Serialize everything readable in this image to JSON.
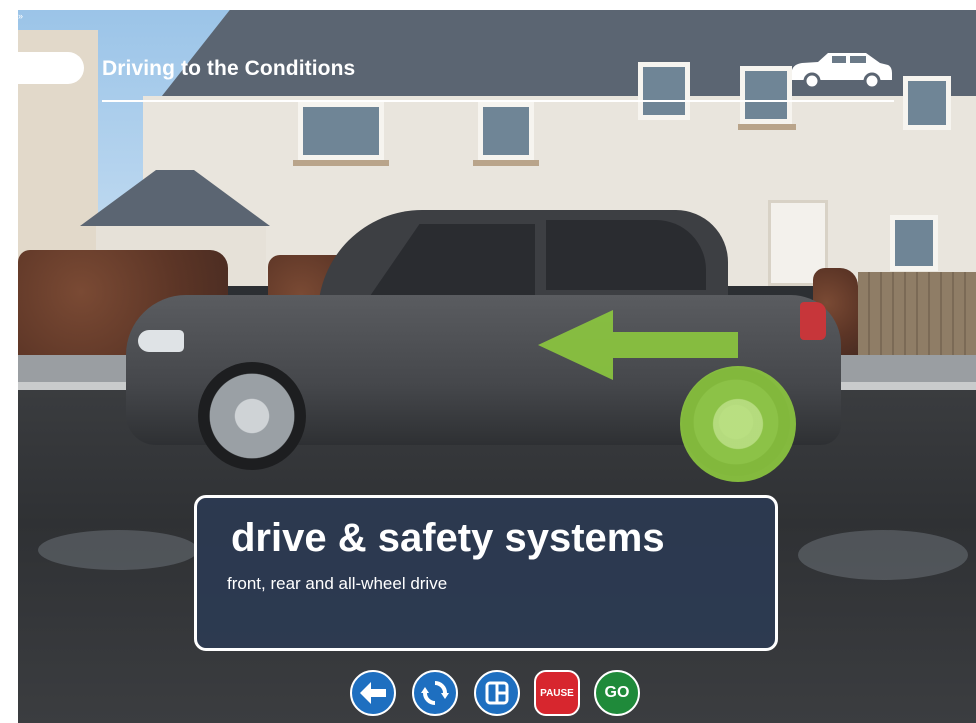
{
  "header": {
    "title": "Driving to the Conditions"
  },
  "card": {
    "heading": "drive & safety systems",
    "subheading": "front, rear and all-wheel drive"
  },
  "controls": {
    "back_icon": "arrow-left-icon",
    "replay_icon": "refresh-icon",
    "menu_icon": "window-grid-icon",
    "pause_label": "PAUSE",
    "go_label": "GO"
  },
  "colors": {
    "card_bg": "#2c3a52",
    "highlight_green": "#8bc53f",
    "button_blue": "#1e6fc0",
    "pause_red": "#d7262e",
    "go_green": "#1f8a3a"
  }
}
